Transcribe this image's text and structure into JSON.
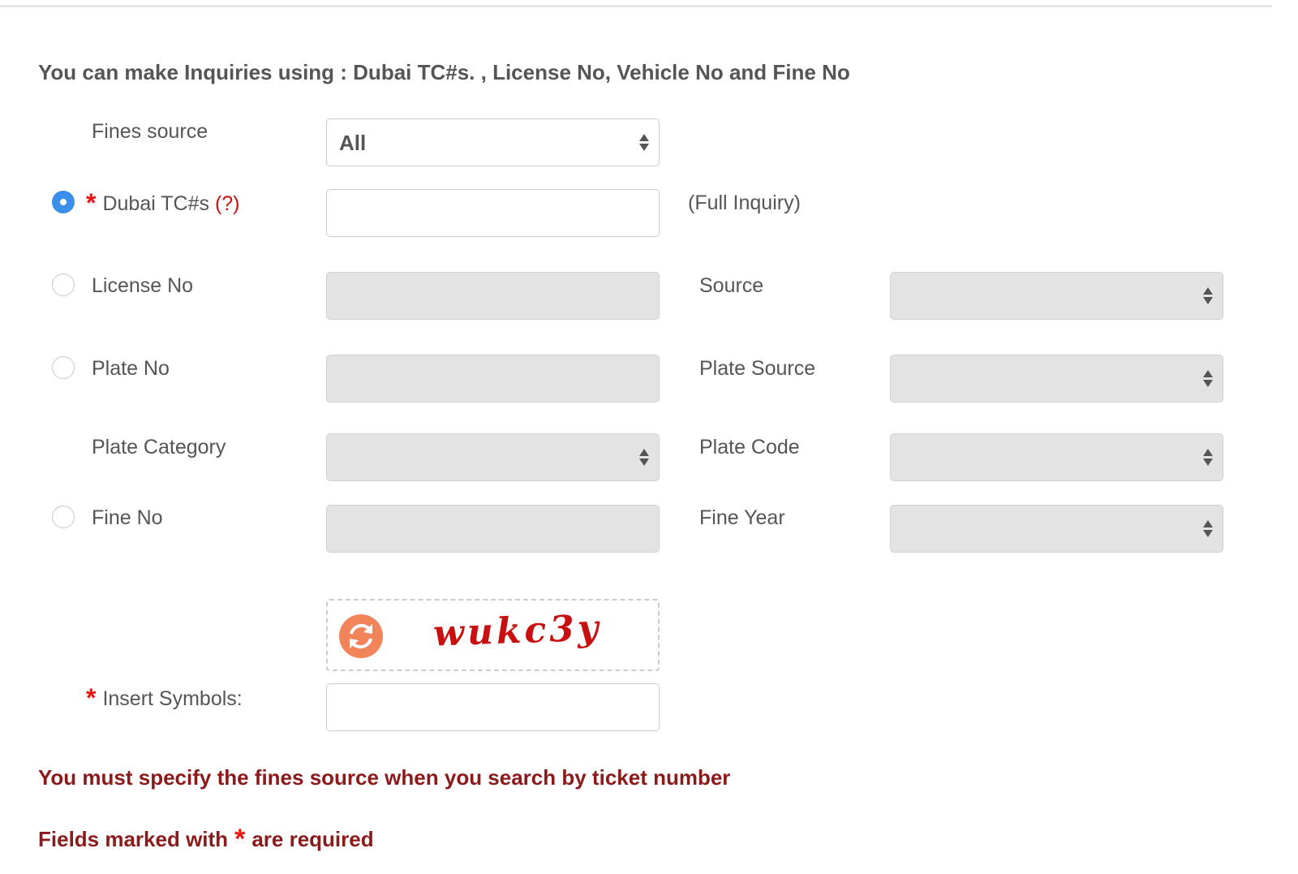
{
  "intro": "You can make Inquiries using : Dubai TC#s. , License No, Vehicle No and Fine No",
  "fines_source": {
    "label": "Fines source",
    "value": "All"
  },
  "dubai_tc": {
    "required_mark": "*",
    "label": "Dubai TC#s",
    "help": "(?)",
    "note": "(Full Inquiry)",
    "value": ""
  },
  "license": {
    "label": "License No",
    "source_label": "Source"
  },
  "plate": {
    "label": "Plate No",
    "source_label": "Plate Source"
  },
  "plate_category": {
    "label": "Plate Category",
    "code_label": "Plate Code"
  },
  "fine": {
    "label": "Fine No",
    "year_label": "Fine Year"
  },
  "captcha": {
    "text": "wukc3y",
    "required_mark": "*",
    "label": "Insert Symbols:",
    "value": ""
  },
  "messages": {
    "source_required": "You must specify the fines source when you search by ticket number",
    "required_prefix": "Fields marked with",
    "required_mark": "*",
    "required_suffix": "are required"
  },
  "colors": {
    "radio_selected": "#3b8eea",
    "required": "#ee1111",
    "message": "#8b1a1a",
    "captcha_text": "#c81010",
    "refresh_icon": "#f2845a",
    "disabled_field": "#e3e3e3"
  }
}
